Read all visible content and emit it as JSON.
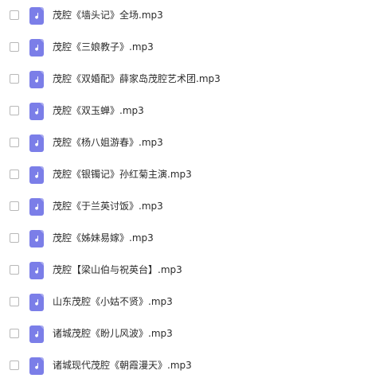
{
  "files": [
    {
      "name": "茂腔《墙头记》全场.mp3",
      "icon": "music-note-icon",
      "selected": false
    },
    {
      "name": "茂腔《三娘教子》.mp3",
      "icon": "music-note-icon",
      "selected": false
    },
    {
      "name": "茂腔《双婚配》薛家岛茂腔艺术团.mp3",
      "icon": "music-note-icon",
      "selected": false
    },
    {
      "name": "茂腔《双玉蝉》.mp3",
      "icon": "music-note-icon",
      "selected": false
    },
    {
      "name": "茂腔《杨八姐游春》.mp3",
      "icon": "music-note-icon",
      "selected": false
    },
    {
      "name": "茂腔《银镯记》孙红菊主演.mp3",
      "icon": "music-note-icon",
      "selected": false
    },
    {
      "name": "茂腔《于兰英讨饭》.mp3",
      "icon": "music-note-icon",
      "selected": false
    },
    {
      "name": "茂腔《姊妹易嫁》.mp3",
      "icon": "music-note-icon",
      "selected": false
    },
    {
      "name": "茂腔【梁山伯与祝英台】.mp3",
      "icon": "music-note-icon",
      "selected": false
    },
    {
      "name": "山东茂腔《小姑不贤》.mp3",
      "icon": "music-note-icon",
      "selected": false
    },
    {
      "name": "诸城茂腔《盼儿风波》.mp3",
      "icon": "music-note-icon",
      "selected": false
    },
    {
      "name": "诸城现代茂腔《朝霞漫天》.mp3",
      "icon": "music-note-icon",
      "selected": false
    }
  ],
  "colors": {
    "icon_bg": "#7b7ee8",
    "checkbox_border": "#b8b8b8",
    "text": "#2b2b2b"
  }
}
